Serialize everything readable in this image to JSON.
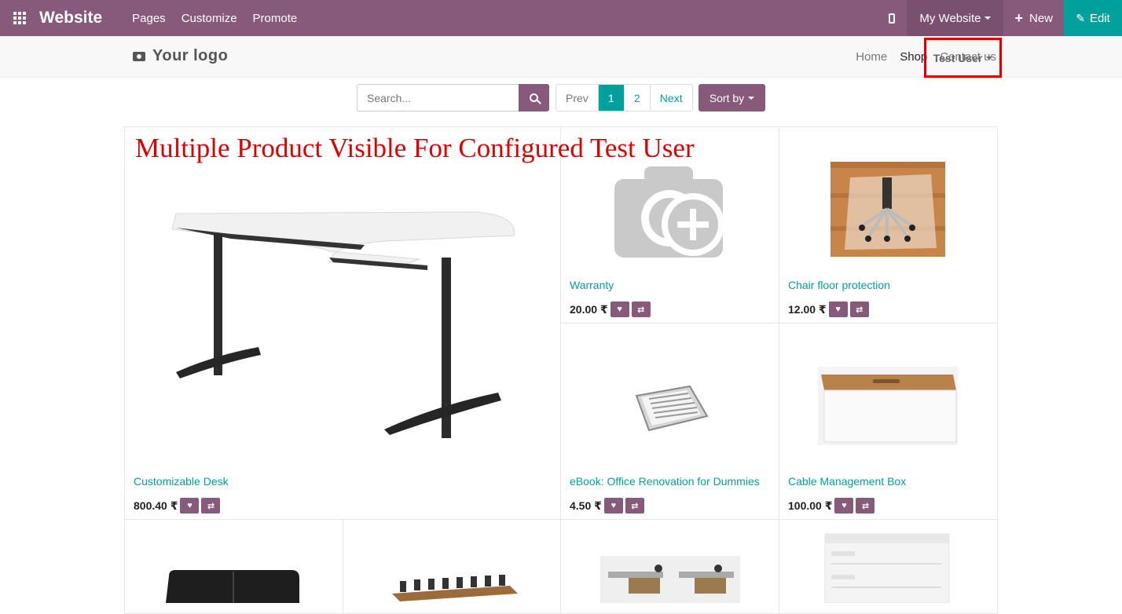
{
  "topbar": {
    "app_title": "Website",
    "menu": [
      "Pages",
      "Customize",
      "Promote"
    ],
    "site_selector": "My Website",
    "new_label": "New",
    "edit_label": "Edit",
    "colors": {
      "bar": "#875A7B",
      "edit": "#00A09D"
    }
  },
  "navbar": {
    "logo_text": "Your logo",
    "links": [
      "Home",
      "Shop",
      "Contact us"
    ],
    "active_link": "Shop",
    "user_menu": "Test User"
  },
  "toolbar": {
    "search_placeholder": "Search...",
    "pager": {
      "prev": "Prev",
      "pages": [
        "1",
        "2"
      ],
      "current": "1",
      "next": "Next"
    },
    "sort_label": "Sort by"
  },
  "annotation": "Multiple Product Visible For Configured Test User",
  "products": [
    {
      "name": "Customizable Desk",
      "price": "800.40 ₹",
      "image": "desk"
    },
    {
      "name": "Warranty",
      "price": "20.00 ₹",
      "image": "placeholder-camera"
    },
    {
      "name": "Chair floor protection",
      "price": "12.00 ₹",
      "image": "chair-floor-mat"
    },
    {
      "name": "eBook: Office Renovation for Dummies",
      "price": "4.50 ₹",
      "image": "ebook"
    },
    {
      "name": "Cable Management Box",
      "price": "100.00 ₹",
      "image": "cable-box"
    },
    {
      "name": "",
      "price": "",
      "image": "sofa"
    },
    {
      "name": "",
      "price": "",
      "image": "conference-table"
    },
    {
      "name": "",
      "price": "",
      "image": "office-desks"
    },
    {
      "name": "",
      "price": "",
      "image": "drawer-cabinet"
    }
  ]
}
